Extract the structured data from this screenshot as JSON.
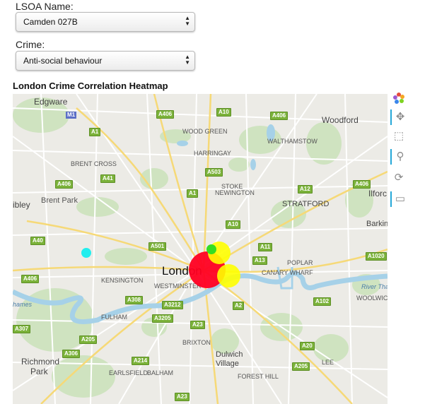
{
  "lsoa": {
    "label": "LSOA Name:",
    "value": "Camden 027B"
  },
  "crime": {
    "label": "Crime:",
    "value": "Anti-social behaviour"
  },
  "map": {
    "title": "London Crime Correlation Heatmap",
    "places": {
      "edgware": "Edgware",
      "woodford": "Woodford",
      "wood_green": "WOOD GREEN",
      "walthamstow": "WALTHAMSTOW",
      "harringay": "HARRINGAY",
      "brent_cross": "BRENT CROSS",
      "stoke": "STOKE",
      "newington": "NEWINGTON",
      "ilford": "Ilforc",
      "wembley": "ibley",
      "brent_park": "Brent Park",
      "stratford": "STRATFORD",
      "barking": "Barkin",
      "london": "London",
      "kensington": "KENSINGTON",
      "westminster": "WESTMINSTER",
      "poplar": "POPLAR",
      "canary_wharf": "CANARY WHARF",
      "fulham": "FULHAM",
      "woolwich": "WOOLWICH",
      "brixton": "BRIXTON",
      "dulwich": "Dulwich",
      "village": "Village",
      "richmond": "Richmond",
      "park": "Park",
      "earlsfield": "EARLSFIELD",
      "balham": "BALHAM",
      "forest_hill": "FOREST HILL",
      "lee": "LEE",
      "river_thames": "River Thame",
      "thames": "hames"
    },
    "roads": {
      "a406a": "A406",
      "a10a": "A10",
      "a406b": "A406",
      "m1": "M1",
      "a1a": "A1",
      "a41": "A41",
      "a406c": "A406",
      "a503": "A503",
      "a1b": "A1",
      "a12": "A12",
      "a406d": "A406",
      "a10b": "A10",
      "a40": "A40",
      "a501": "A501",
      "a11": "A11",
      "a13": "A13",
      "a1020": "A1020",
      "a406e": "A406",
      "a308": "A308",
      "a3212": "A3212",
      "a3205": "A3205",
      "a2": "A2",
      "a102": "A102",
      "a307": "A307",
      "a23a": "A23",
      "a205a": "A205",
      "a306": "A306",
      "a214": "A214",
      "a20": "A20",
      "a205b": "A205",
      "a23b": "A23"
    },
    "markers": [
      {
        "color": "#ff0022",
        "value": "high"
      },
      {
        "color": "#ffff00",
        "value": "medium"
      },
      {
        "color": "#ffff00",
        "value": "medium"
      },
      {
        "color": "#33dd22",
        "value": "low"
      },
      {
        "color": "#22eeee",
        "value": "low"
      }
    ]
  },
  "toolbar": {
    "logo_icon": "bokeh-logo-icon",
    "pan_icon": "pan-icon",
    "box_zoom_icon": "box-zoom-icon",
    "wheel_zoom_icon": "wheel-zoom-icon",
    "reset_icon": "reset-icon",
    "hover_icon": "hover-icon"
  }
}
